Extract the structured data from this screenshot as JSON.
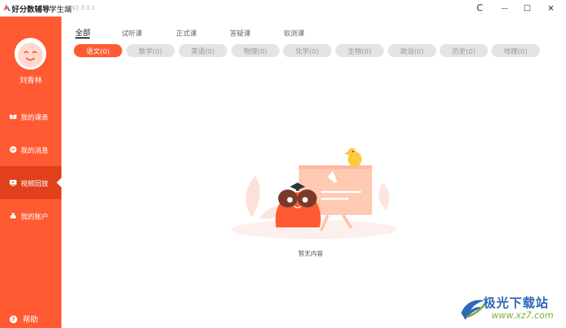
{
  "titlebar": {
    "app_name": "好分数辅导",
    "app_sub": "· 学生端",
    "version": "V2.3.0.1",
    "controls": {
      "refresh": "C",
      "minimize": "—",
      "maximize": "☐",
      "close": "✕"
    }
  },
  "sidebar": {
    "username": "刘青林",
    "items": [
      {
        "label": "我的课表",
        "icon": "book-icon",
        "active": false
      },
      {
        "label": "我的消息",
        "icon": "message-icon",
        "active": false
      },
      {
        "label": "视频回放",
        "icon": "video-icon",
        "active": true
      },
      {
        "label": "我的账户",
        "icon": "money-bag-icon",
        "active": false
      }
    ],
    "help_label": "帮助",
    "help_icon_glyph": "?"
  },
  "tabs": [
    {
      "label": "全部",
      "active": true
    },
    {
      "label": "试听课",
      "active": false
    },
    {
      "label": "正式课",
      "active": false
    },
    {
      "label": "答疑课",
      "active": false
    },
    {
      "label": "软测课",
      "active": false
    }
  ],
  "subjects": [
    {
      "label": "语文(0)",
      "active": true
    },
    {
      "label": "数学(0)",
      "active": false
    },
    {
      "label": "英语(0)",
      "active": false
    },
    {
      "label": "物理(0)",
      "active": false
    },
    {
      "label": "化学(0)",
      "active": false
    },
    {
      "label": "生物(0)",
      "active": false
    },
    {
      "label": "政治(0)",
      "active": false
    },
    {
      "label": "历史(0)",
      "active": false
    },
    {
      "label": "地理(0)",
      "active": false
    }
  ],
  "empty_state": {
    "text": "暂无内容"
  },
  "watermark": {
    "title": "极光下载站",
    "url": "www.xz7.com"
  },
  "colors": {
    "accent": "#ff5a32",
    "accent_dark": "#e1401d",
    "pill_bg": "#e4e4e4"
  }
}
